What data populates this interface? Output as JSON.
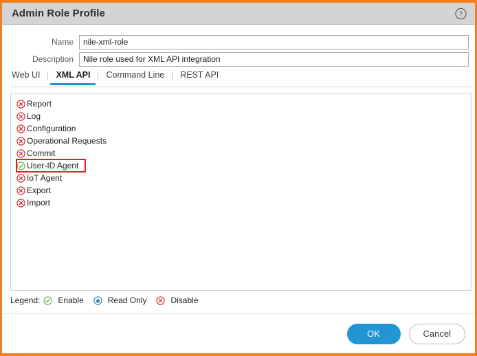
{
  "window": {
    "title": "Admin Role Profile",
    "help_icon": "question-mark-circle-icon",
    "accent_color": "#f38020",
    "titlebar_color": "#d4d4d4"
  },
  "form": {
    "name": {
      "label": "Name",
      "value": "nile-xml-role",
      "placeholder": ""
    },
    "description": {
      "label": "Description",
      "value": "Nile role used for XML API integration",
      "placeholder": ""
    }
  },
  "tabs": [
    {
      "label": "Web UI",
      "active": false
    },
    {
      "label": "XML API",
      "active": true
    },
    {
      "label": "Command Line",
      "active": false
    },
    {
      "label": "REST API",
      "active": false
    }
  ],
  "tab_active_color": "#2196d3",
  "permissions": [
    {
      "label": "Report",
      "state": "disable",
      "icon": "x-circle-icon",
      "highlighted": false
    },
    {
      "label": "Log",
      "state": "disable",
      "icon": "x-circle-icon",
      "highlighted": false
    },
    {
      "label": "Configuration",
      "state": "disable",
      "icon": "x-circle-icon",
      "highlighted": false
    },
    {
      "label": "Operational Requests",
      "state": "disable",
      "icon": "x-circle-icon",
      "highlighted": false
    },
    {
      "label": "Commit",
      "state": "disable",
      "icon": "x-circle-icon",
      "highlighted": false
    },
    {
      "label": "User-ID Agent",
      "state": "enable",
      "icon": "check-circle-icon",
      "highlighted": true
    },
    {
      "label": "IoT Agent",
      "state": "disable",
      "icon": "x-circle-icon",
      "highlighted": false
    },
    {
      "label": "Export",
      "state": "disable",
      "icon": "x-circle-icon",
      "highlighted": false
    },
    {
      "label": "Import",
      "state": "disable",
      "icon": "x-circle-icon",
      "highlighted": false
    }
  ],
  "highlight_color": "#e31f1f",
  "legend": {
    "title": "Legend:",
    "items": [
      {
        "label": "Enable",
        "icon": "check-circle-icon",
        "color": "#6aa84f"
      },
      {
        "label": "Read Only",
        "icon": "read-only-circle-icon",
        "color": "#2a7fc1"
      },
      {
        "label": "Disable",
        "icon": "x-circle-icon",
        "color": "#cc2127"
      }
    ]
  },
  "footer": {
    "ok_label": "OK",
    "cancel_label": "Cancel",
    "ok_color": "#2196d3"
  }
}
